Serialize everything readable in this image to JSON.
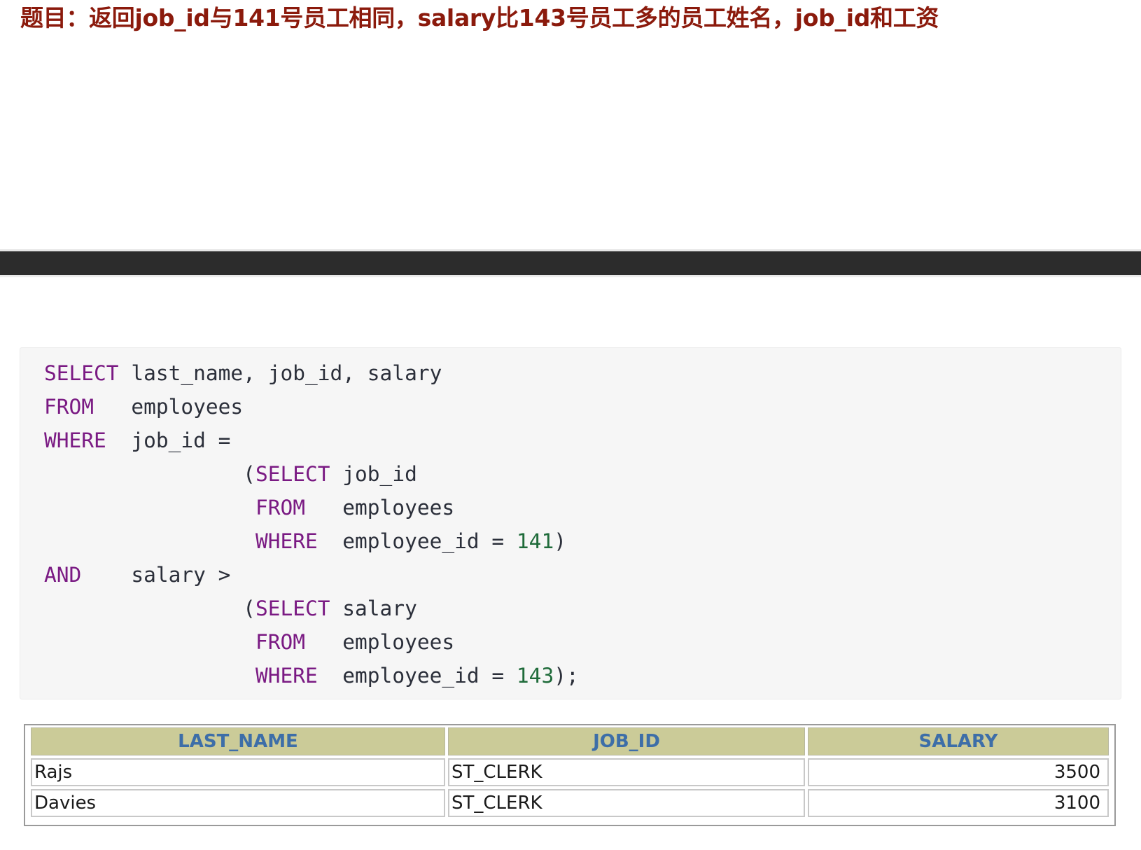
{
  "title": "题目：返回job_id与141号员工相同，salary比143号员工多的员工姓名，job_id和工资",
  "code": {
    "lines": [
      [
        {
          "t": "SELECT",
          "c": "kw"
        },
        {
          "t": " last_name, job_id, salary",
          "c": ""
        }
      ],
      [
        {
          "t": "FROM",
          "c": "kw"
        },
        {
          "t": "   employees",
          "c": ""
        }
      ],
      [
        {
          "t": "WHERE",
          "c": "kw"
        },
        {
          "t": "  job_id =",
          "c": ""
        }
      ],
      [
        {
          "t": "                (",
          "c": ""
        },
        {
          "t": "SELECT",
          "c": "kw"
        },
        {
          "t": " job_id",
          "c": ""
        }
      ],
      [
        {
          "t": "                 ",
          "c": ""
        },
        {
          "t": "FROM",
          "c": "kw"
        },
        {
          "t": "   employees",
          "c": ""
        }
      ],
      [
        {
          "t": "                 ",
          "c": ""
        },
        {
          "t": "WHERE",
          "c": "kw"
        },
        {
          "t": "  employee_id = ",
          "c": ""
        },
        {
          "t": "141",
          "c": "num"
        },
        {
          "t": ")",
          "c": ""
        }
      ],
      [
        {
          "t": "AND",
          "c": "kw"
        },
        {
          "t": "    salary >",
          "c": ""
        }
      ],
      [
        {
          "t": "                (",
          "c": ""
        },
        {
          "t": "SELECT",
          "c": "kw"
        },
        {
          "t": " salary",
          "c": ""
        }
      ],
      [
        {
          "t": "                 ",
          "c": ""
        },
        {
          "t": "FROM",
          "c": "kw"
        },
        {
          "t": "   employees",
          "c": ""
        }
      ],
      [
        {
          "t": "                 ",
          "c": ""
        },
        {
          "t": "WHERE",
          "c": "kw"
        },
        {
          "t": "  employee_id = ",
          "c": ""
        },
        {
          "t": "143",
          "c": "num"
        },
        {
          "t": ");",
          "c": ""
        }
      ]
    ]
  },
  "result": {
    "headers": [
      "LAST_NAME",
      "JOB_ID",
      "SALARY"
    ],
    "rows": [
      [
        "Rajs",
        "ST_CLERK",
        "3500"
      ],
      [
        "Davies",
        "ST_CLERK",
        "3100"
      ]
    ]
  },
  "colors": {
    "title": "#8b1a0c",
    "keyword": "#7a1a83",
    "number": "#1f6b3a",
    "header_bg": "#cbcb98",
    "header_text": "#3d6ea8"
  }
}
